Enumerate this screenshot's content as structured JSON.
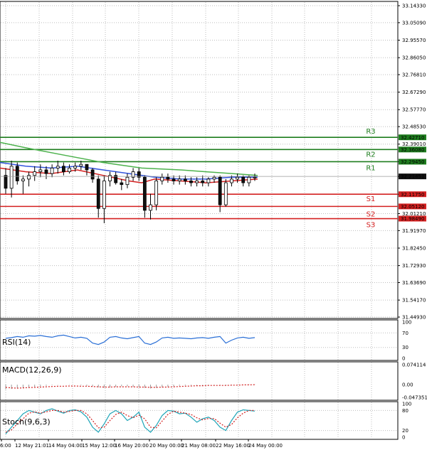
{
  "chart_data": {
    "type": "candlestick",
    "main_panel": {
      "y_range": [
        31.4493,
        33.1433
      ],
      "price_ticks": [
        "33.14330",
        "33.05090",
        "32.95570",
        "32.86050",
        "32.76810",
        "32.67290",
        "32.57770",
        "32.48530",
        "32.39010",
        "32.29450",
        "32.21451",
        "32.11750",
        "32.01210",
        "31.91970",
        "31.82450",
        "31.72930",
        "31.63690",
        "31.54170",
        "31.44930"
      ],
      "current_price": "32.21451",
      "levels": [
        {
          "name": "R3",
          "value": 32.4271,
          "label": "32.42710",
          "color": "#1e7d1e"
        },
        {
          "name": "R2",
          "value": 32.3608,
          "label": "32.36080",
          "color": "#1e7d1e"
        },
        {
          "name": "R1",
          "value": 32.2945,
          "label": "32.29450",
          "color": "#1e7d1e"
        },
        {
          "name": "S1",
          "value": 32.1175,
          "label": "32.11750",
          "color": "#d42020"
        },
        {
          "name": "S2",
          "value": 32.0512,
          "label": "32.05120",
          "color": "#d42020"
        },
        {
          "name": "S3",
          "value": 31.9849,
          "label": "31.98490",
          "color": "#d42020"
        }
      ],
      "candles": [
        [
          32.22,
          32.26,
          32.12,
          32.15
        ],
        [
          32.15,
          32.3,
          32.1,
          32.27
        ],
        [
          32.27,
          32.29,
          32.17,
          32.19
        ],
        [
          32.19,
          32.22,
          32.12,
          32.2
        ],
        [
          32.2,
          32.24,
          32.16,
          32.22
        ],
        [
          32.22,
          32.27,
          32.19,
          32.24
        ],
        [
          32.24,
          32.28,
          32.21,
          32.25
        ],
        [
          32.25,
          32.27,
          32.2,
          32.23
        ],
        [
          32.23,
          32.28,
          32.21,
          32.26
        ],
        [
          32.26,
          32.3,
          32.23,
          32.27
        ],
        [
          32.27,
          32.29,
          32.22,
          32.24
        ],
        [
          32.24,
          32.28,
          32.23,
          32.26
        ],
        [
          32.26,
          32.29,
          32.24,
          32.27
        ],
        [
          32.27,
          32.3,
          32.25,
          32.28
        ],
        [
          32.28,
          32.28,
          32.22,
          32.25
        ],
        [
          32.25,
          32.26,
          32.18,
          32.2
        ],
        [
          32.2,
          32.22,
          31.99,
          32.04
        ],
        [
          32.04,
          32.22,
          31.96,
          32.19
        ],
        [
          32.19,
          32.24,
          32.16,
          32.22
        ],
        [
          32.22,
          32.24,
          32.17,
          32.18
        ],
        [
          32.18,
          32.2,
          32.14,
          32.17
        ],
        [
          32.17,
          32.23,
          32.15,
          32.21
        ],
        [
          32.21,
          32.26,
          32.19,
          32.24
        ],
        [
          32.24,
          32.26,
          32.19,
          32.21
        ],
        [
          32.21,
          32.22,
          31.99,
          32.03
        ],
        [
          32.03,
          32.12,
          31.98,
          32.06
        ],
        [
          32.06,
          32.21,
          32.03,
          32.19
        ],
        [
          32.19,
          32.23,
          32.17,
          32.21
        ],
        [
          32.21,
          32.23,
          32.18,
          32.2
        ],
        [
          32.2,
          32.22,
          32.17,
          32.19
        ],
        [
          32.19,
          32.22,
          32.17,
          32.2
        ],
        [
          32.2,
          32.22,
          32.17,
          32.19
        ],
        [
          32.19,
          32.21,
          32.16,
          32.18
        ],
        [
          32.18,
          32.21,
          32.16,
          32.19
        ],
        [
          32.19,
          32.22,
          32.16,
          32.18
        ],
        [
          32.18,
          32.21,
          32.16,
          32.2
        ],
        [
          32.2,
          32.22,
          32.18,
          32.21
        ],
        [
          32.21,
          32.22,
          32.02,
          32.06
        ],
        [
          32.06,
          32.2,
          32.05,
          32.18
        ],
        [
          32.18,
          32.22,
          32.16,
          32.2
        ],
        [
          32.2,
          32.23,
          32.18,
          32.21
        ],
        [
          32.21,
          32.22,
          32.16,
          32.18
        ],
        [
          32.18,
          32.22,
          32.16,
          32.21
        ],
        [
          32.21,
          32.23,
          32.19,
          32.21
        ]
      ],
      "ma_green": [
        [
          0,
          32.4
        ],
        [
          0.1,
          32.37
        ],
        [
          0.25,
          32.33
        ],
        [
          0.4,
          32.29
        ],
        [
          0.55,
          32.26
        ],
        [
          0.7,
          32.25
        ],
        [
          0.8,
          32.24
        ],
        [
          0.9,
          32.23
        ],
        [
          1,
          32.22
        ]
      ],
      "ma_blue": [
        [
          0,
          32.29
        ],
        [
          0.1,
          32.27
        ],
        [
          0.2,
          32.26
        ],
        [
          0.3,
          32.27
        ],
        [
          0.4,
          32.25
        ],
        [
          0.5,
          32.23
        ],
        [
          0.6,
          32.21
        ],
        [
          0.7,
          32.2
        ],
        [
          0.8,
          32.2
        ],
        [
          0.9,
          32.21
        ],
        [
          1,
          32.21
        ]
      ],
      "ma_red": [
        [
          0,
          32.26
        ],
        [
          0.1,
          32.24
        ],
        [
          0.2,
          32.23
        ],
        [
          0.3,
          32.25
        ],
        [
          0.4,
          32.22
        ],
        [
          0.5,
          32.19
        ],
        [
          0.55,
          32.18
        ],
        [
          0.6,
          32.2
        ],
        [
          0.7,
          32.19
        ],
        [
          0.8,
          32.18
        ],
        [
          0.9,
          32.19
        ],
        [
          1,
          32.2
        ]
      ]
    },
    "rsi_panel": {
      "name": "RSI(14)",
      "ticks": [
        "100",
        "70",
        "30",
        "0"
      ],
      "y_range": [
        0,
        100
      ],
      "values": [
        55,
        57,
        60,
        58,
        62,
        61,
        63,
        60,
        58,
        62,
        64,
        60,
        56,
        58,
        55,
        42,
        38,
        45,
        58,
        60,
        56,
        54,
        57,
        60,
        42,
        38,
        45,
        56,
        58,
        55,
        56,
        55,
        54,
        56,
        57,
        55,
        58,
        60,
        42,
        50,
        56,
        58,
        55,
        57
      ]
    },
    "macd_panel": {
      "name": "MACD(12,26,9)",
      "ticks": [
        "0.074114",
        "0.00",
        "-0.047351"
      ],
      "y_range": [
        -0.047351,
        0.074114
      ],
      "hist": [
        -0.018,
        -0.016,
        -0.014,
        -0.012,
        -0.01,
        -0.008,
        -0.006,
        -0.004,
        -0.002,
        -0.001,
        0.0,
        0.001,
        0.0,
        -0.002,
        -0.004,
        -0.006,
        -0.01,
        -0.012,
        -0.01,
        -0.008,
        -0.006,
        -0.006,
        -0.008,
        -0.01,
        -0.012,
        -0.014,
        -0.012,
        -0.01,
        -0.008,
        -0.006,
        -0.004,
        -0.003,
        -0.002,
        -0.002,
        -0.002,
        -0.001,
        -0.001,
        -0.002,
        -0.003,
        -0.002,
        -0.001,
        0.0,
        0.001,
        0.001
      ],
      "signal": [
        -0.01,
        -0.012,
        -0.013,
        -0.012,
        -0.011,
        -0.01,
        -0.009,
        -0.008,
        -0.007,
        -0.006,
        -0.006,
        -0.005,
        -0.005,
        -0.006,
        -0.006,
        -0.007,
        -0.008,
        -0.009,
        -0.009,
        -0.008,
        -0.008,
        -0.008,
        -0.008,
        -0.009,
        -0.009,
        -0.01,
        -0.01,
        -0.009,
        -0.009,
        -0.008,
        -0.007,
        -0.006,
        -0.005,
        -0.004,
        -0.004,
        -0.003,
        -0.003,
        -0.003,
        -0.003,
        -0.002,
        -0.002,
        -0.001,
        -0.001,
        0.0
      ]
    },
    "stoch_panel": {
      "name": "Stoch(9,6,3)",
      "ticks": [
        "100",
        "80",
        "20",
        "0"
      ],
      "y_range": [
        0,
        100
      ],
      "main": [
        10,
        30,
        50,
        70,
        80,
        75,
        70,
        80,
        85,
        78,
        72,
        80,
        82,
        76,
        60,
        30,
        15,
        40,
        70,
        80,
        70,
        50,
        60,
        75,
        30,
        15,
        35,
        65,
        80,
        78,
        70,
        72,
        60,
        45,
        55,
        60,
        50,
        30,
        20,
        50,
        75,
        82,
        80,
        78
      ],
      "signal": [
        15,
        22,
        40,
        55,
        72,
        76,
        72,
        76,
        80,
        80,
        75,
        77,
        80,
        80,
        70,
        50,
        28,
        30,
        50,
        68,
        75,
        65,
        58,
        66,
        55,
        30,
        28,
        48,
        68,
        78,
        75,
        72,
        68,
        58,
        52,
        56,
        56,
        42,
        30,
        38,
        58,
        72,
        80,
        80
      ]
    },
    "x_labels": [
      "6:00",
      "12 May 21:01",
      "14 May 04:00",
      "15 May 12:00",
      "16 May 20:00",
      "20 May 00:00",
      "21 May 08:00",
      "22 May 16:00",
      "24 May 00:00"
    ]
  }
}
